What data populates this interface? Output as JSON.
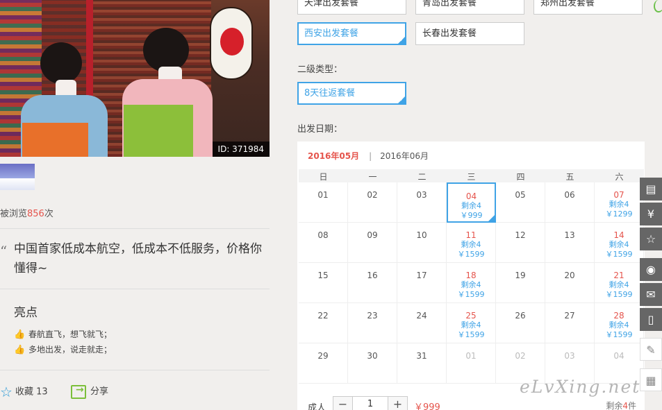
{
  "hero": {
    "image_id": "ID: 371984"
  },
  "views": {
    "prefix": "被浏览",
    "count": "856",
    "suffix": "次"
  },
  "quote": {
    "mark": "“",
    "text": "中国首家低成本航空，低成本不低服务，价格你懂得~"
  },
  "highlights": {
    "title": "亮点",
    "items": [
      "春航直飞，想飞就飞；",
      "多地出发，说走就走；"
    ]
  },
  "actions": {
    "favorite_label": "收藏",
    "favorite_count": "13",
    "share_label": "分享"
  },
  "packages": {
    "row1": [
      "天津出发套餐",
      "青岛出发套餐",
      "郑州出发套餐"
    ],
    "row2": [
      "西安出发套餐",
      "长春出发套餐"
    ],
    "selected": "西安出发套餐"
  },
  "subtype": {
    "label": "二级类型：",
    "options": [
      "8天往返套餐"
    ]
  },
  "date": {
    "label": "出发日期："
  },
  "calendar": {
    "active_month": "2016年05月",
    "separator": "|",
    "other_month": "2016年06月",
    "weekdays": [
      "日",
      "一",
      "二",
      "三",
      "四",
      "五",
      "六"
    ],
    "weeks": [
      [
        {
          "d": "01"
        },
        {
          "d": "02"
        },
        {
          "d": "03"
        },
        {
          "d": "04",
          "red": true,
          "r": "剩余4",
          "p": "￥999",
          "sel": true
        },
        {
          "d": "05"
        },
        {
          "d": "06"
        },
        {
          "d": "07",
          "red": true,
          "r": "剩余4",
          "p": "￥1299"
        }
      ],
      [
        {
          "d": "08"
        },
        {
          "d": "09"
        },
        {
          "d": "10"
        },
        {
          "d": "11",
          "red": true,
          "r": "剩余4",
          "p": "￥1599"
        },
        {
          "d": "12"
        },
        {
          "d": "13"
        },
        {
          "d": "14",
          "red": true,
          "r": "剩余4",
          "p": "￥1599"
        }
      ],
      [
        {
          "d": "15"
        },
        {
          "d": "16"
        },
        {
          "d": "17"
        },
        {
          "d": "18",
          "red": true,
          "r": "剩余4",
          "p": "￥1599"
        },
        {
          "d": "19"
        },
        {
          "d": "20"
        },
        {
          "d": "21",
          "red": true,
          "r": "剩余4",
          "p": "￥1599"
        }
      ],
      [
        {
          "d": "22"
        },
        {
          "d": "23"
        },
        {
          "d": "24"
        },
        {
          "d": "25",
          "red": true,
          "r": "剩余4",
          "p": "￥1599"
        },
        {
          "d": "26"
        },
        {
          "d": "27"
        },
        {
          "d": "28",
          "red": true,
          "r": "剩余4",
          "p": "￥1599"
        }
      ],
      [
        {
          "d": "29"
        },
        {
          "d": "30"
        },
        {
          "d": "31"
        },
        {
          "d": "01",
          "grey": true
        },
        {
          "d": "02",
          "grey": true
        },
        {
          "d": "03",
          "grey": true
        },
        {
          "d": "04",
          "grey": true
        }
      ]
    ]
  },
  "quantity": {
    "label": "成人",
    "minus": "−",
    "value": "1",
    "plus": "+",
    "price": "￥999",
    "remain_prefix": "剩余",
    "remain_count": "4",
    "remain_suffix": "件"
  },
  "watermark": "eLvXing.net",
  "sidebar_icons": [
    "clipboard-icon",
    "yen-icon",
    "star-icon",
    "weibo-icon",
    "wechat-icon",
    "mobile-icon",
    "pencil-icon",
    "qrcode-icon"
  ]
}
